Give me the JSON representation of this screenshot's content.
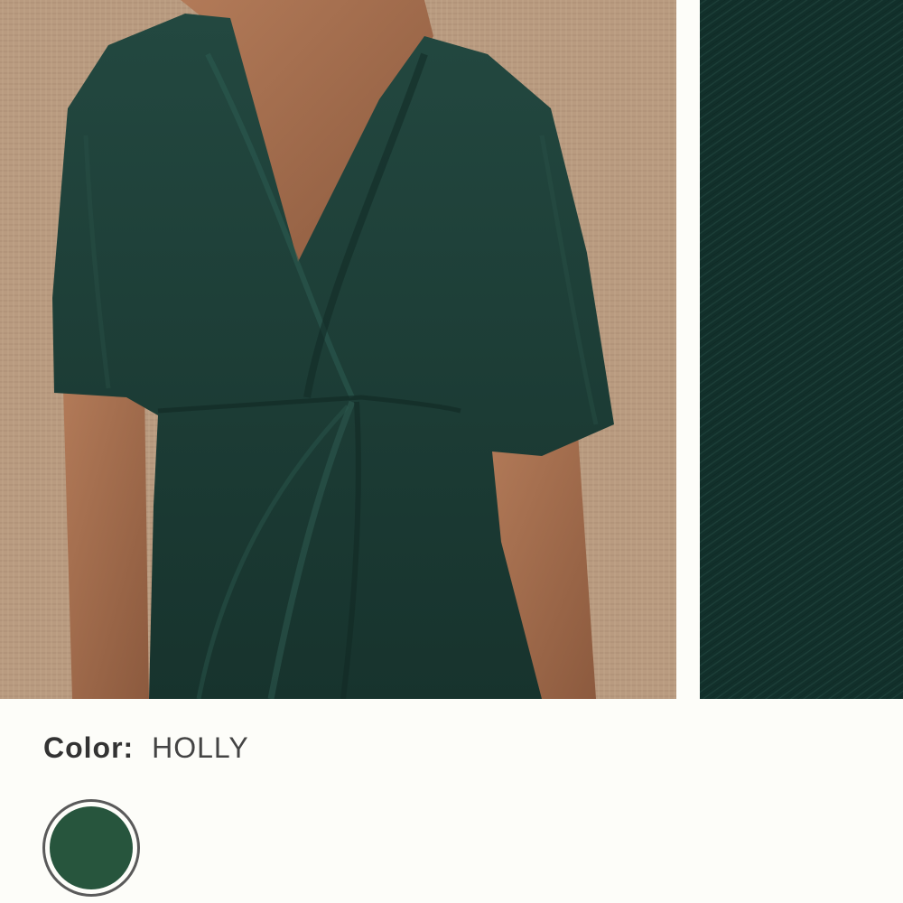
{
  "product": {
    "color_label": "Color:",
    "color_name": "HOLLY",
    "swatch_color": "#27553d",
    "dress_color": "#1e3e36",
    "background_color": "#b89a80"
  }
}
